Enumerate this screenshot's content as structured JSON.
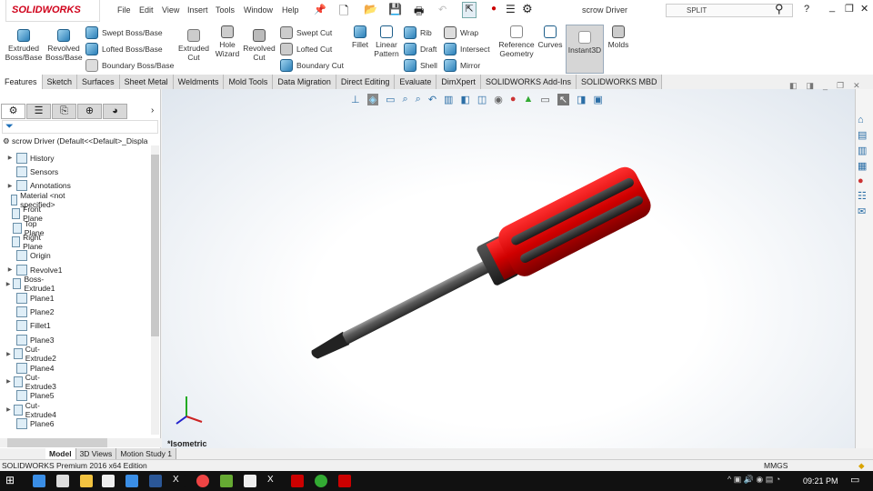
{
  "app": {
    "logo": "SOLIDWORKS",
    "doc_title": "scrow Driver",
    "search_value": "SPLIT"
  },
  "menu": [
    "File",
    "Edit",
    "View",
    "Insert",
    "Tools",
    "Window",
    "Help"
  ],
  "ribbon": {
    "big": [
      {
        "label": "Extruded Boss/Base"
      },
      {
        "label": "Revolved Boss/Base"
      },
      {
        "label": "Extruded Cut"
      },
      {
        "label": "Hole Wizard"
      },
      {
        "label": "Revolved Cut"
      },
      {
        "label": "Fillet"
      },
      {
        "label": "Linear Pattern"
      },
      {
        "label": "Reference Geometry"
      },
      {
        "label": "Curves"
      },
      {
        "label": "Instant3D"
      },
      {
        "label": "Molds"
      }
    ],
    "small": [
      "Swept Boss/Base",
      "Lofted Boss/Base",
      "Boundary Boss/Base",
      "Swept Cut",
      "Lofted Cut",
      "Boundary Cut",
      "Rib",
      "Draft",
      "Shell",
      "Wrap",
      "Intersect",
      "Mirror"
    ]
  },
  "tabs": [
    "Features",
    "Sketch",
    "Surfaces",
    "Sheet Metal",
    "Weldments",
    "Mold Tools",
    "Data Migration",
    "Direct Editing",
    "Evaluate",
    "DimXpert",
    "SOLIDWORKS Add-Ins",
    "SOLIDWORKS MBD"
  ],
  "tree": {
    "root": "scrow Driver  (Default<<Default>_Displa",
    "items": [
      {
        "label": "History",
        "exp": true
      },
      {
        "label": "Sensors",
        "exp": false
      },
      {
        "label": "Annotations",
        "exp": true
      },
      {
        "label": "Material <not specified>",
        "exp": false
      },
      {
        "label": "Front Plane",
        "exp": false
      },
      {
        "label": "Top Plane",
        "exp": false
      },
      {
        "label": "Right Plane",
        "exp": false
      },
      {
        "label": "Origin",
        "exp": false
      },
      {
        "label": "Revolve1",
        "exp": true
      },
      {
        "label": "Boss-Extrude1",
        "exp": true
      },
      {
        "label": "Plane1",
        "exp": false
      },
      {
        "label": "Plane2",
        "exp": false
      },
      {
        "label": "Fillet1",
        "exp": false
      },
      {
        "label": "Plane3",
        "exp": false
      },
      {
        "label": "Cut-Extrude2",
        "exp": true
      },
      {
        "label": "Plane4",
        "exp": false
      },
      {
        "label": "Cut-Extrude3",
        "exp": true
      },
      {
        "label": "Plane5",
        "exp": false
      },
      {
        "label": "Cut-Extrude4",
        "exp": true
      },
      {
        "label": "Plane6",
        "exp": false
      }
    ]
  },
  "viewport": {
    "view_label": "*Isometric"
  },
  "bottom_tabs": [
    "Model",
    "3D Views",
    "Motion Study 1"
  ],
  "status": {
    "edition": "SOLIDWORKS Premium 2016 x64 Edition",
    "units": "MMGS"
  },
  "taskbar": {
    "time": "09:21 PM"
  },
  "colors": {
    "handle_red": "#d40000",
    "accent": "#1d6fb8"
  }
}
